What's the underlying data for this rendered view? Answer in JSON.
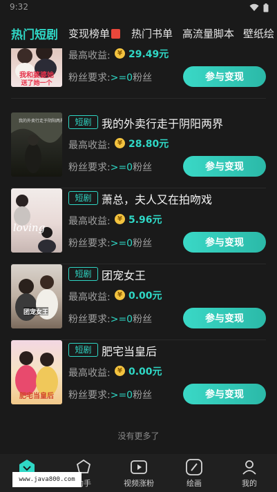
{
  "status_bar": {
    "time": "9:32"
  },
  "tabs": [
    {
      "label": "热门短剧",
      "active": true
    },
    {
      "label": "变现榜单",
      "badge": true
    },
    {
      "label": "热门书单"
    },
    {
      "label": "高流量脚本"
    },
    {
      "label": "壁纸绘"
    }
  ],
  "dramas": [
    {
      "tag": "短剧",
      "title": "",
      "earn_label": "最高收益:",
      "coin": "¥",
      "earn_value": "29.49元",
      "fans_prefix": "粉丝要求:",
      "fans_value": ">=0",
      "fans_suffix": "粉丝",
      "button": "参与变现",
      "poster_text": "我和婆婆她",
      "poster_subtext": "送了她一个"
    },
    {
      "tag": "短剧",
      "title": "我的外卖行走于阴阳两界",
      "earn_label": "最高收益:",
      "coin": "¥",
      "earn_value": "28.80元",
      "fans_prefix": "粉丝要求:",
      "fans_value": ">=0",
      "fans_suffix": "粉丝",
      "button": "参与变现",
      "poster_text": "我的外卖行走于阴阳两界",
      "poster_subtext": ""
    },
    {
      "tag": "短剧",
      "title": "萧总，夫人又在拍吻戏",
      "earn_label": "最高收益:",
      "coin": "¥",
      "earn_value": "5.96元",
      "fans_prefix": "粉丝要求:",
      "fans_value": ">=0",
      "fans_suffix": "粉丝",
      "button": "参与变现",
      "poster_text": "loving",
      "poster_subtext": ""
    },
    {
      "tag": "短剧",
      "title": "团宠女王",
      "earn_label": "最高收益:",
      "coin": "¥",
      "earn_value": "0.00元",
      "fans_prefix": "粉丝要求:",
      "fans_value": ">=0",
      "fans_suffix": "粉丝",
      "button": "参与变现",
      "poster_text": "团宠女王",
      "poster_subtext": ""
    },
    {
      "tag": "短剧",
      "title": "肥宅当皇后",
      "earn_label": "最高收益:",
      "coin": "¥",
      "earn_value": "0.00元",
      "fans_prefix": "粉丝要求:",
      "fans_value": ">=0",
      "fans_suffix": "粉丝",
      "button": "参与变现",
      "poster_text": "肥宅当皇后",
      "poster_subtext": ""
    }
  ],
  "footer_text": "没有更多了",
  "bottom_nav": [
    {
      "label": "",
      "icon": "home-icon",
      "active": true
    },
    {
      "label": "助手",
      "icon": "assistant-icon"
    },
    {
      "label": "视频涨粉",
      "icon": "video-play-icon"
    },
    {
      "label": "绘画",
      "icon": "paint-icon"
    },
    {
      "label": "我的",
      "icon": "user-icon"
    }
  ],
  "watermark": "www.java800.com",
  "colors": {
    "accent": "#2fd8c6",
    "background": "#1a1a1a",
    "coin": "#f3c33f"
  }
}
